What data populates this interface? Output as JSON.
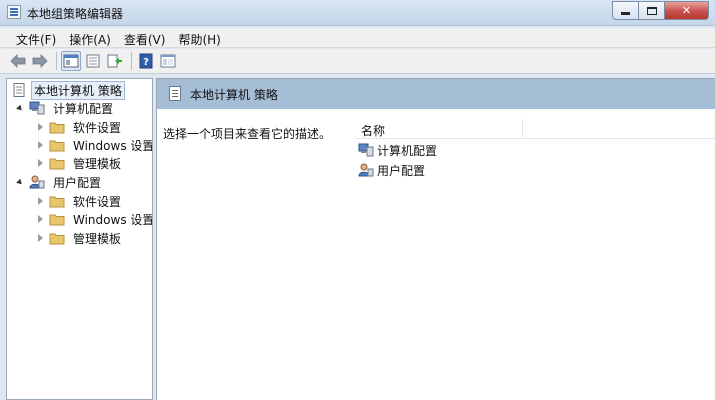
{
  "window": {
    "title": "本地组策略编辑器"
  },
  "menu": [
    {
      "label": "文件(F)"
    },
    {
      "label": "操作(A)"
    },
    {
      "label": "查看(V)"
    },
    {
      "label": "帮助(H)"
    }
  ],
  "toolbar": {
    "icons": [
      "back-arrow-icon",
      "forward-arrow-icon",
      "show-hide-console-tree-icon",
      "properties-icon",
      "export-list-icon",
      "help-icon",
      "extended-view-icon"
    ]
  },
  "tree": {
    "root": "本地计算机 策略",
    "computer_config": "计算机配置",
    "computer_children": [
      "软件设置",
      "Windows 设置",
      "管理模板"
    ],
    "user_config": "用户配置",
    "user_children": [
      "软件设置",
      "Windows 设置",
      "管理模板"
    ]
  },
  "details": {
    "header_title": "本地计算机 策略",
    "description": "选择一个项目来查看它的描述。",
    "column_name": "名称",
    "items": [
      "计算机配置",
      "用户配置"
    ]
  },
  "colors": {
    "header_band": "#a6bdd6",
    "selection": "#e6eef9",
    "folder": "#e8c66a"
  }
}
